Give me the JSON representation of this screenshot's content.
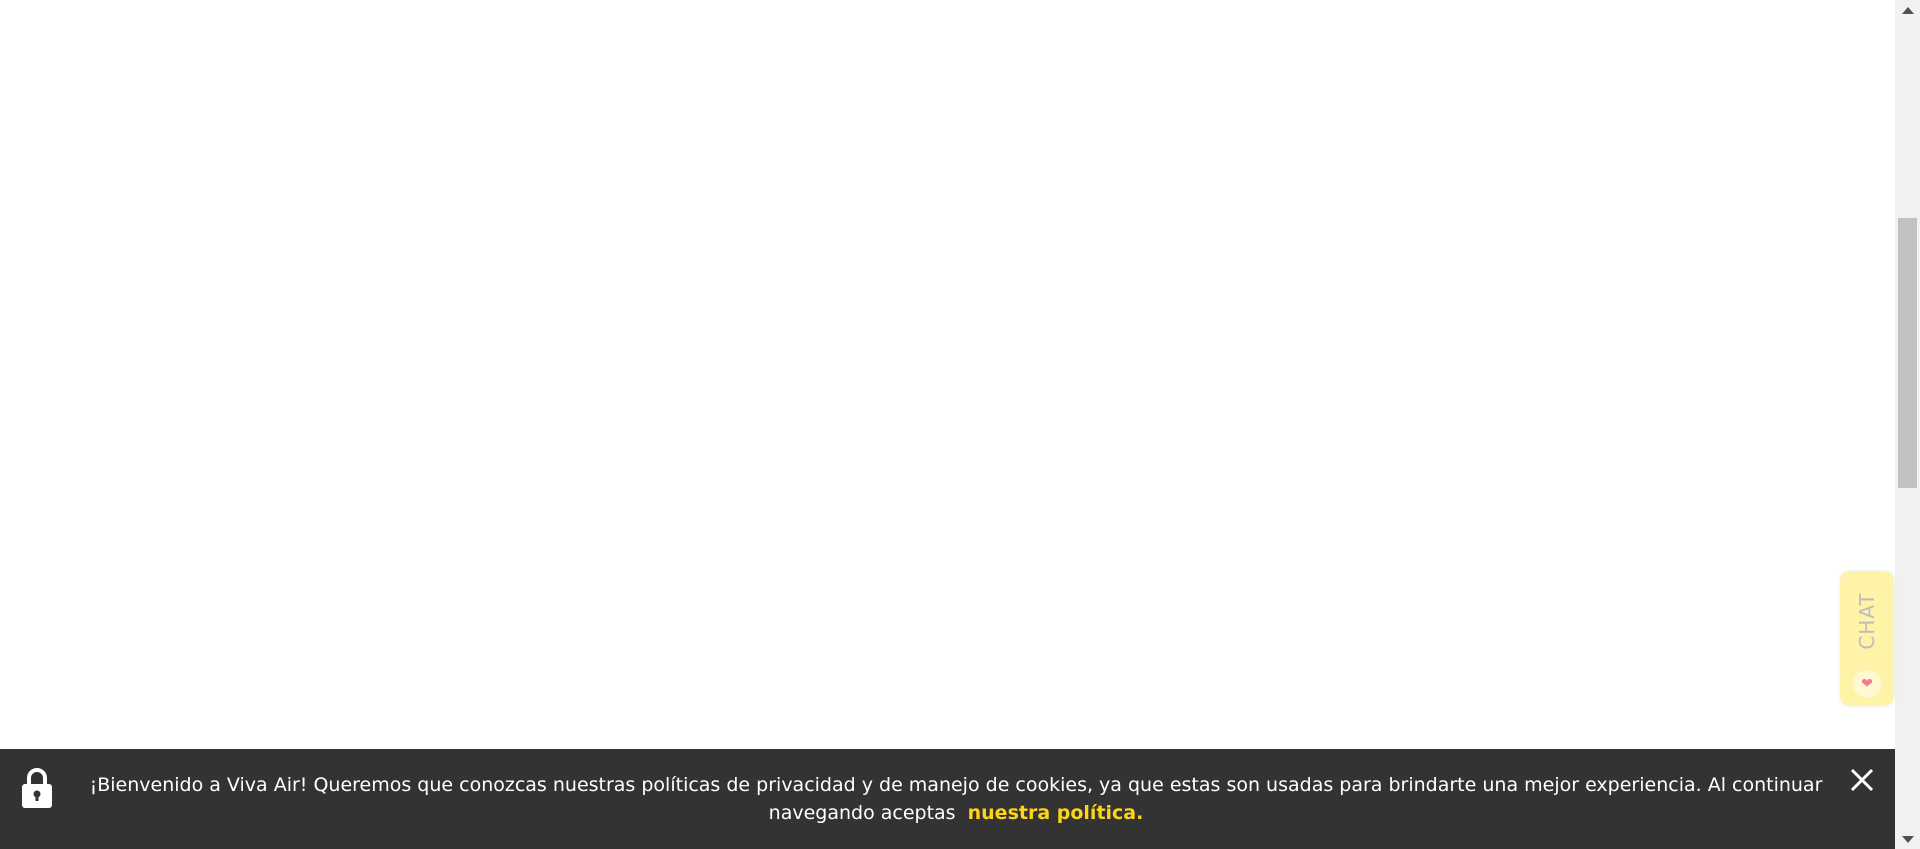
{
  "chat": {
    "label": "CHAT",
    "icon": "heart-icon",
    "background_color": "#fff3a8"
  },
  "cookie_banner": {
    "message": "¡Bienvenido a Viva Air! Queremos que conozcas nuestras políticas de privacidad y de manejo de cookies, ya que estas son usadas para brindarte una mejor experiencia. Al continuar navegando aceptas",
    "link_label": "nuestra política.",
    "lock_icon": "lock-icon",
    "close_icon": "close-icon",
    "background_color": "#333333",
    "link_color": "#fcd419"
  }
}
